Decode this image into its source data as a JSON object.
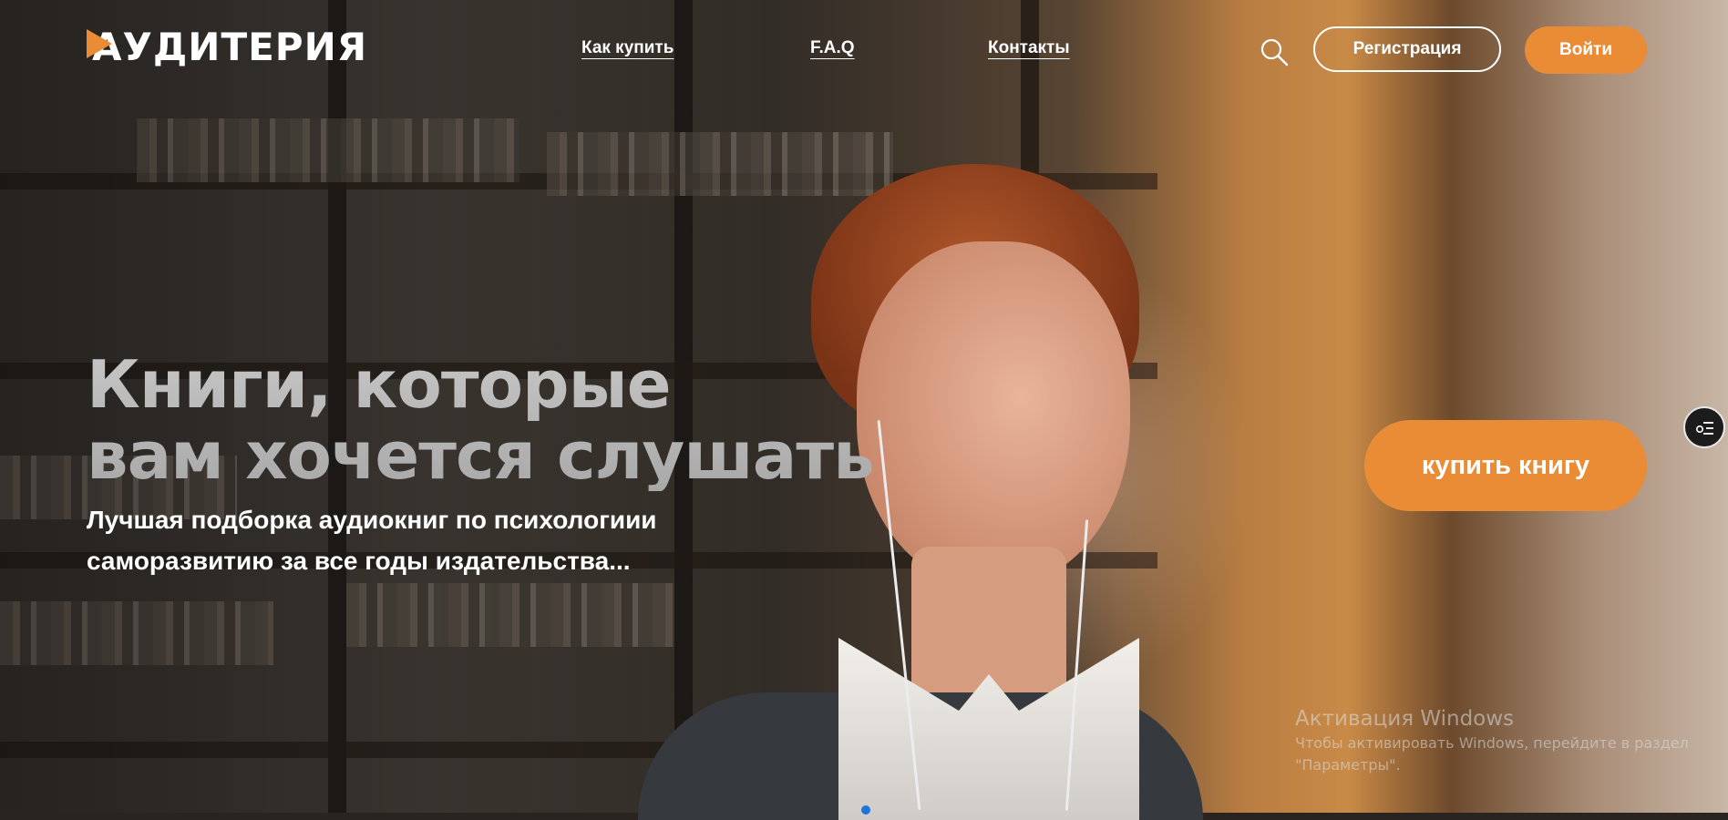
{
  "header": {
    "logo_text": "АУДИТЕРИЯ",
    "nav": [
      {
        "label": "Как купить"
      },
      {
        "label": "F.A.Q"
      },
      {
        "label": "Контакты"
      }
    ],
    "search_icon": "search-icon",
    "register_label": "Регистрация",
    "login_label": "Войти"
  },
  "hero": {
    "title_line1": "Книги, которые",
    "title_line2": "вам хочется слушать",
    "subtitle_line1": "Лучшая подборка аудиокниг по психологиии",
    "subtitle_line2": "саморазвитию за все годы издательства...",
    "buy_label": "купить книгу"
  },
  "side_widget": {
    "icon": "list-settings-icon"
  },
  "windows_watermark": {
    "title": "Активация Windows",
    "line1": "Чтобы активировать Windows, перейдите в раздел",
    "line2": "\"Параметры\"."
  },
  "colors": {
    "accent": "#e98c35",
    "text": "#ffffff",
    "slider_dot": "#1f74d8"
  }
}
